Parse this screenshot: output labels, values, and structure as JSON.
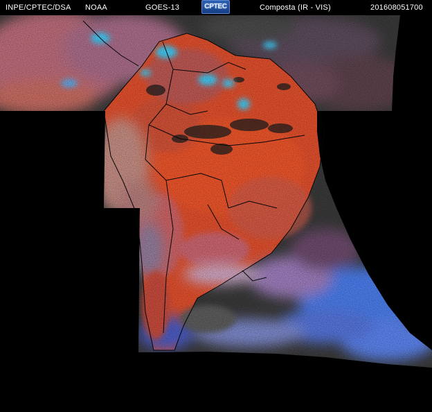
{
  "header": {
    "agency": "INPE/CPTEC/DSA",
    "partner": "NOAA",
    "satellite": "GOES-13",
    "logo_text": "CPTEC",
    "product": "Composta (IR - VIS)",
    "timestamp": "201608051700"
  },
  "colors": {
    "background": "#000000",
    "land_warm": "#e0502a",
    "land_dry": "#c86a5a",
    "cloud_cold": "#36c6f0",
    "ocean_cloud_blue": "#4a78e0",
    "ocean_clear": "#3a3a3a",
    "cloud_pink": "#d08aa8",
    "border_lines": "#0a0a0a"
  },
  "icons": {
    "logo": "cptec-logo-icon"
  }
}
